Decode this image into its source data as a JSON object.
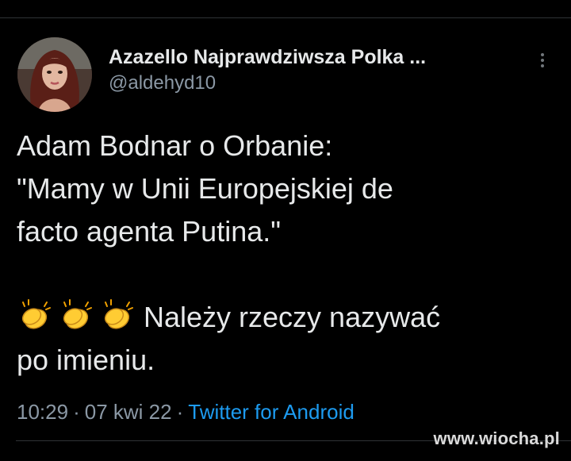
{
  "tweet": {
    "author": {
      "display_name": "Azazello Najprawdziwsza Polka ...",
      "handle": "@aldehyd10",
      "avatar_icon": "profile-photo"
    },
    "more_icon": "vertical-ellipsis-icon",
    "text": {
      "line1": "Adam Bodnar o Orbanie:",
      "line2": "\"Mamy w Unii Europejskiej de",
      "line3": "facto agenta Putina.\"",
      "emoji": [
        "clapping-hands-emoji",
        "clapping-hands-emoji",
        "clapping-hands-emoji"
      ],
      "line4": "Należy rzeczy nazywać",
      "line5": "po imieniu."
    },
    "meta": {
      "time": "10:29",
      "separator": "·",
      "date": "07 kwi 22",
      "source": "Twitter for Android"
    }
  },
  "watermark": "www.wiocha.pl",
  "colors": {
    "background": "#000000",
    "text": "#e7e9ea",
    "secondary": "#8b98a5",
    "link": "#1d9bf0",
    "emoji": "#ffcc33"
  }
}
